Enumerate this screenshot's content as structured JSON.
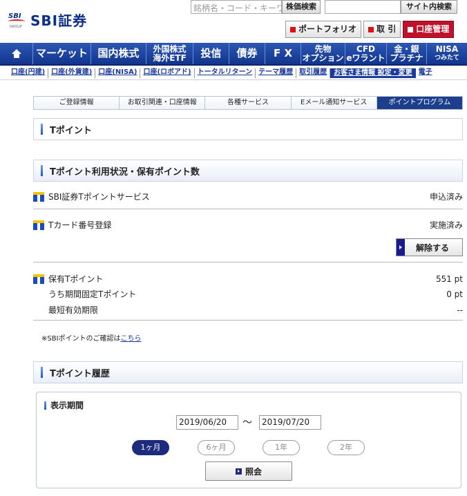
{
  "header": {
    "logo_mark": "SBI",
    "logo_group": "GROUP",
    "logo_name": "SBI証券",
    "search_placeholder": "銘柄名・コード・キーワード",
    "stock_search_label": "株価検索",
    "site_search_label": "サイト内検索",
    "buttons": [
      {
        "label": "ポートフォリオ"
      },
      {
        "label": "取 引"
      },
      {
        "label": "口座管理"
      }
    ]
  },
  "main_nav": [
    {
      "label": "マーケット"
    },
    {
      "label": "国内株式"
    },
    {
      "label": "外国株式海外ETF",
      "line1": "外国株式",
      "line2": "海外ETF"
    },
    {
      "label": "投信"
    },
    {
      "label": "債券"
    },
    {
      "label": "F X"
    },
    {
      "label": "先物オプション",
      "line1": "先物",
      "line2": "オプション"
    },
    {
      "label": "CFD eワラント",
      "line1": "CFD",
      "line2": "eワラント"
    },
    {
      "label": "金・銀プラチナ",
      "line1": "金・銀",
      "line2": "プラチナ"
    },
    {
      "label": "NISAつみたて",
      "line1": "NISA",
      "line2": "つみたて"
    }
  ],
  "sub_nav": [
    "口座(円建)",
    "口座(外貨建)",
    "口座(NISA)",
    "口座(ロボアド)",
    "トータルリターン",
    "テーマ履歴",
    "取引履歴",
    "お客さま情報 設定・変更",
    "電子"
  ],
  "tabs": [
    "ご登録情報",
    "お取引関連・口座情報",
    "各種サービス",
    "Eメール通知サービス",
    "ポイントプログラム"
  ],
  "page_title": "Tポイント",
  "status_section": {
    "title": "Tポイント利用状況・保有ポイント数",
    "service_label": "SBI証券Tポイントサービス",
    "service_value": "申込済み",
    "card_label": "Tカード番号登録",
    "card_value": "実施済み",
    "release_button": "解除する",
    "held_label": "保有Tポイント",
    "held_value": "551 pt",
    "fixed_label": "うち期間固定Tポイント",
    "fixed_value": "0 pt",
    "expiry_label": "最短有効期限",
    "expiry_value": "--"
  },
  "note": {
    "text": "※SBIポイントのご確認は",
    "link": "こちら"
  },
  "history_section": {
    "title": "Tポイント履歴",
    "period_label": "表示期間",
    "date_from": "2019/06/20",
    "tilde": "〜",
    "date_to": "2019/07/20",
    "ranges": [
      "1ヶ月",
      "6ヶ月",
      "1年",
      "2年"
    ],
    "inquire_button": "照会"
  }
}
